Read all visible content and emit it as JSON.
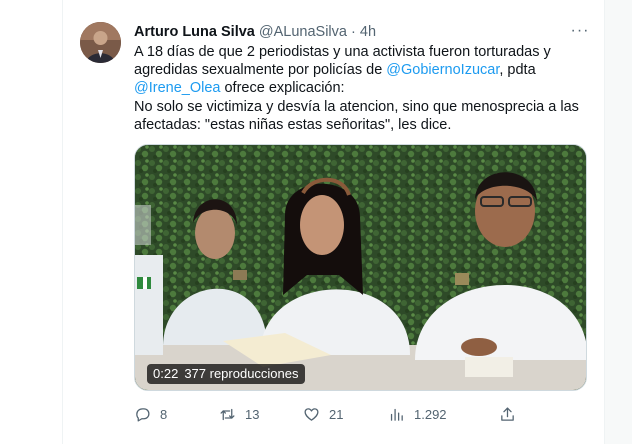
{
  "tweet": {
    "author_name": "Arturo Luna Silva",
    "handle": "@ALunaSilva",
    "separator": "·",
    "time": "4h",
    "more_glyph": "···",
    "text": {
      "line1": "A 18 días de que 2 periodistas y una activista fueron torturadas y",
      "line2_before": "agredidas sexualmente por policías de ",
      "mention_gobierno": "@GobiernoIzucar",
      "line2_after": ", pdta",
      "mention_irene": "@Irene_Olea",
      "line3_after": " ofrece explicación:",
      "line4": "No solo se victimiza y desvía la atencion, sino que menosprecia a las",
      "line5": "afectadas: \"estas niñas estas señoritas\", les dice."
    },
    "media": {
      "duration": "0:22",
      "views": "377 reproducciones"
    },
    "actions": {
      "replies": "8",
      "retweets": "13",
      "likes": "21",
      "views": "1.292"
    }
  },
  "icons": {
    "reply": "reply-icon",
    "retweet": "retweet-icon",
    "like": "heart-icon",
    "views": "bar-chart-icon",
    "share": "share-icon",
    "more": "more-icon"
  },
  "colors": {
    "link": "#1d9bf0",
    "secondary": "#536471",
    "text": "#0f1419"
  }
}
